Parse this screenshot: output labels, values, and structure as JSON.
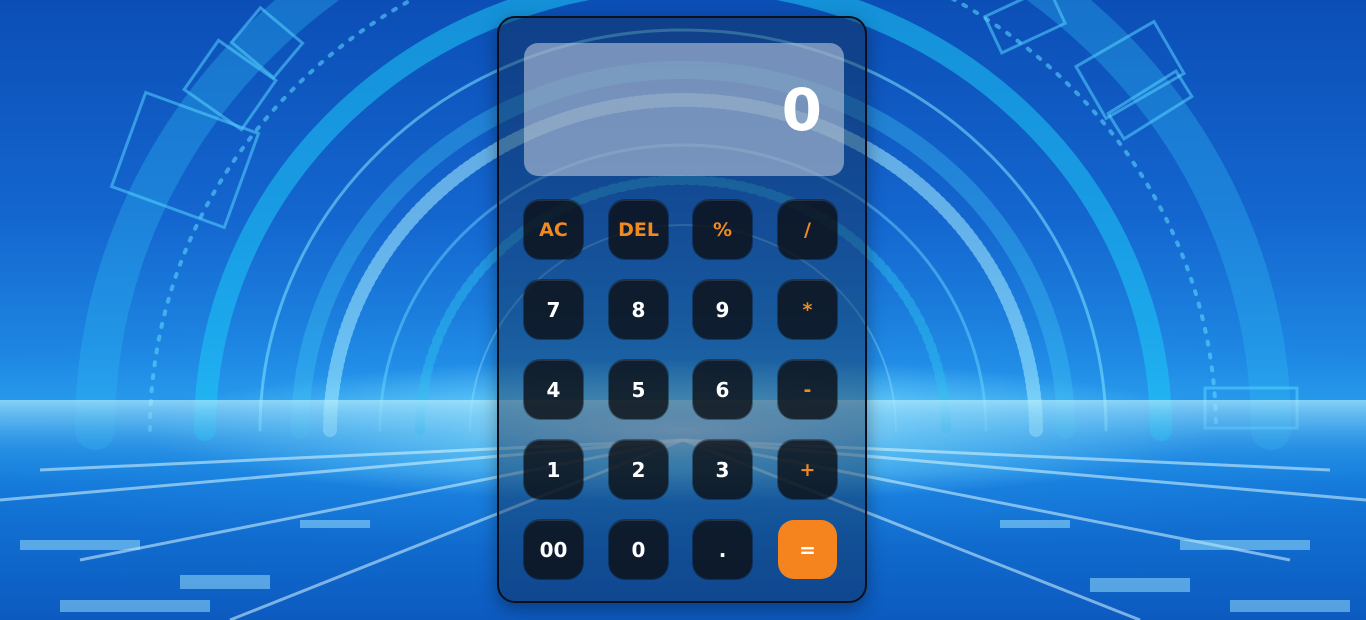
{
  "calculator": {
    "display_value": "0",
    "keys": {
      "ac": "AC",
      "del": "DEL",
      "percent": "%",
      "divide": "/",
      "seven": "7",
      "eight": "8",
      "nine": "9",
      "multiply": "*",
      "four": "4",
      "five": "5",
      "six": "6",
      "subtract": "-",
      "one": "1",
      "two": "2",
      "three": "3",
      "add": "+",
      "double_zero": "00",
      "zero": "0",
      "decimal": ".",
      "equals": "="
    }
  },
  "colors": {
    "operator_text": "#f08a1e",
    "equals_bg": "#f5841f",
    "key_bg": "#0c1016",
    "display_bg": "#c8d2e1"
  }
}
